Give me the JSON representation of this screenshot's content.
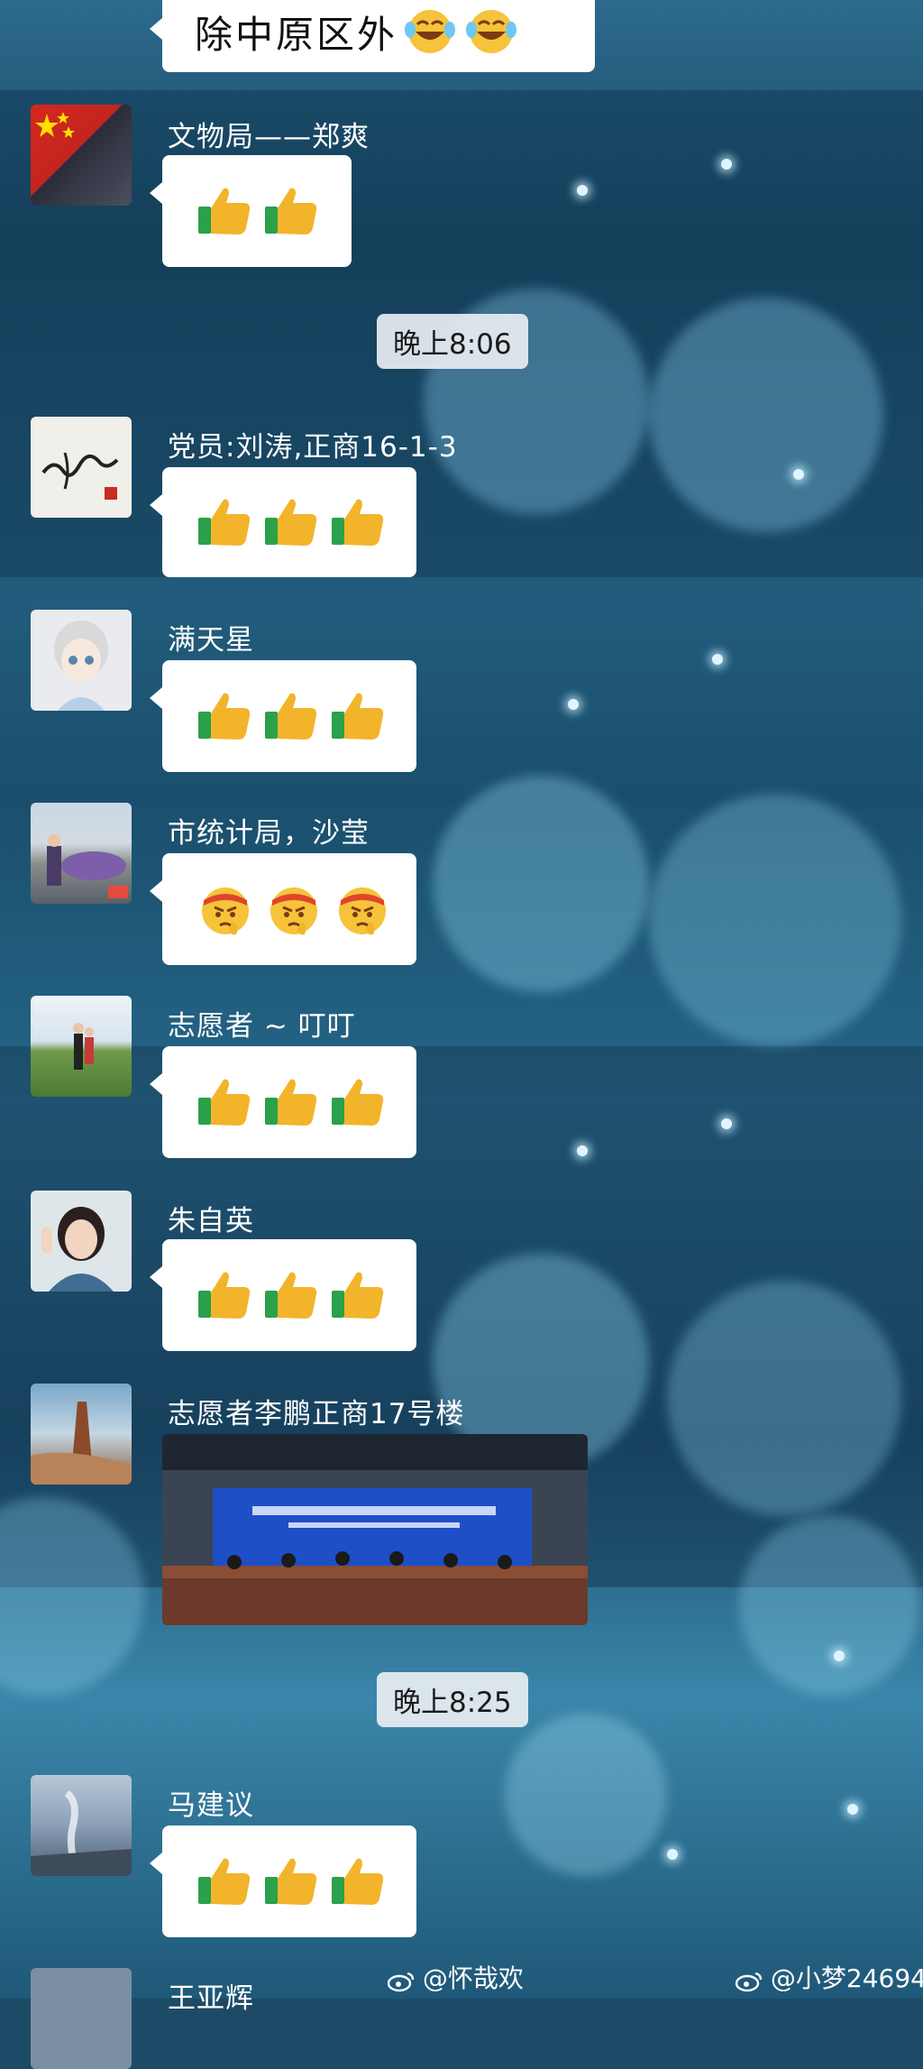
{
  "top_message": {
    "text": "除中原区外",
    "emoji": "laugh-cry"
  },
  "messages": [
    {
      "sender": "文物局——郑爽",
      "emoji": "thumbs-up",
      "count": 2
    },
    {
      "time": "晚上8:06"
    },
    {
      "sender": "党员:刘涛,正商16-1-3",
      "emoji": "thumbs-up",
      "count": 3
    },
    {
      "sender": "满天星",
      "emoji": "thumbs-up",
      "count": 3
    },
    {
      "sender": "市统计局，沙莹",
      "emoji": "determined-face",
      "count": 3
    },
    {
      "sender": "志愿者 ~ 叮叮",
      "emoji": "thumbs-up",
      "count": 3
    },
    {
      "sender": "朱自英",
      "emoji": "thumbs-up",
      "count": 3
    },
    {
      "sender": "志愿者李鹏正商17号楼",
      "attachment": "image-press-conference"
    },
    {
      "time": "晚上8:25"
    },
    {
      "sender": "马建议",
      "emoji": "thumbs-up",
      "count": 3
    },
    {
      "sender": "王亚辉"
    }
  ],
  "watermarks": [
    "@怀哉欢",
    "@小梦24694"
  ],
  "colors": {
    "bubble": "#ffffff",
    "thumb": "#f2b42a",
    "cuff": "#2aa14a",
    "name_text": "#ffffff"
  }
}
